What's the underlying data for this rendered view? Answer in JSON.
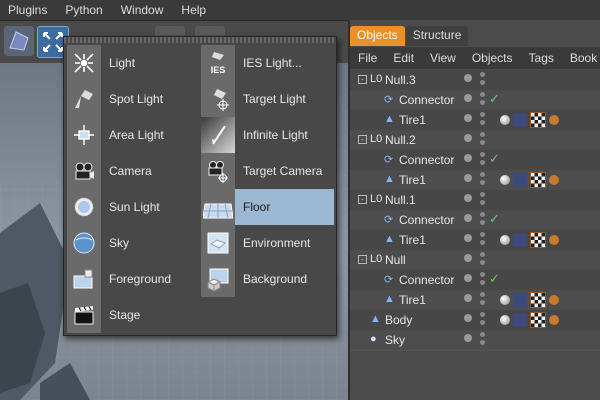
{
  "menubar": {
    "items": [
      "Plugins",
      "Python",
      "Window",
      "Help"
    ]
  },
  "toolbar": {
    "buttons": [
      "model-tool-icon",
      "light-tool-icon",
      "render-icon",
      "render-settings-icon"
    ]
  },
  "popup": {
    "left_column": [
      {
        "label": "Light",
        "icon": "light-icon"
      },
      {
        "label": "Spot Light",
        "icon": "spot-light-icon"
      },
      {
        "label": "Area Light",
        "icon": "area-light-icon"
      },
      {
        "label": "Camera",
        "icon": "camera-icon"
      },
      {
        "label": "Sun Light",
        "icon": "sun-light-icon"
      },
      {
        "label": "Sky",
        "icon": "sky-icon"
      },
      {
        "label": "Foreground",
        "icon": "foreground-icon"
      },
      {
        "label": "Stage",
        "icon": "stage-icon"
      }
    ],
    "right_column": [
      {
        "label": "IES Light...",
        "icon": "ies-light-icon",
        "icon_text": "IES"
      },
      {
        "label": "Target Light",
        "icon": "target-light-icon"
      },
      {
        "label": "Infinite Light",
        "icon": "infinite-light-icon"
      },
      {
        "label": "Target Camera",
        "icon": "target-camera-icon"
      },
      {
        "label": "Floor",
        "icon": "floor-icon",
        "selected": true
      },
      {
        "label": "Environment",
        "icon": "environment-icon"
      },
      {
        "label": "Background",
        "icon": "background-icon"
      }
    ]
  },
  "object_manager": {
    "tabs": [
      {
        "label": "Objects",
        "active": true
      },
      {
        "label": "Structure",
        "active": false
      }
    ],
    "menus": [
      "File",
      "Edit",
      "View",
      "Objects",
      "Tags",
      "Book"
    ],
    "rows": [
      {
        "name": "Null.3",
        "type": "null",
        "level": 0,
        "expand": "-",
        "tags": []
      },
      {
        "name": "Connector",
        "type": "connector",
        "level": 1,
        "check": true,
        "tags": []
      },
      {
        "name": "Tire1",
        "type": "tire",
        "level": 1,
        "tags": [
          "sphere",
          "uvw",
          "tex",
          "mat"
        ]
      },
      {
        "name": "Null.2",
        "type": "null",
        "level": 0,
        "expand": "-",
        "tags": []
      },
      {
        "name": "Connector",
        "type": "connector",
        "level": 1,
        "check": true,
        "tags": []
      },
      {
        "name": "Tire1",
        "type": "tire",
        "level": 1,
        "tags": [
          "sphere",
          "uvw",
          "tex",
          "mat"
        ]
      },
      {
        "name": "Null.1",
        "type": "null",
        "level": 0,
        "expand": "-",
        "tags": []
      },
      {
        "name": "Connector",
        "type": "connector",
        "level": 1,
        "check": true,
        "tags": []
      },
      {
        "name": "Tire1",
        "type": "tire",
        "level": 1,
        "tags": [
          "sphere",
          "uvw",
          "tex",
          "mat"
        ]
      },
      {
        "name": "Null",
        "type": "null",
        "level": 0,
        "expand": "-",
        "tags": []
      },
      {
        "name": "Connector",
        "type": "connector",
        "level": 1,
        "check": true,
        "tags": []
      },
      {
        "name": "Tire1",
        "type": "tire",
        "level": 1,
        "tags": [
          "sphere",
          "uvw",
          "tex",
          "mat"
        ]
      },
      {
        "name": "Body",
        "type": "body",
        "level": 0,
        "tags": [
          "sphere",
          "uvw",
          "tex",
          "mat"
        ]
      },
      {
        "name": "Sky",
        "type": "sky",
        "level": 0,
        "tags": []
      }
    ]
  },
  "colors": {
    "active_tab": "#e9902a",
    "selection": "#9bb7d3",
    "check": "#6ec46e"
  }
}
